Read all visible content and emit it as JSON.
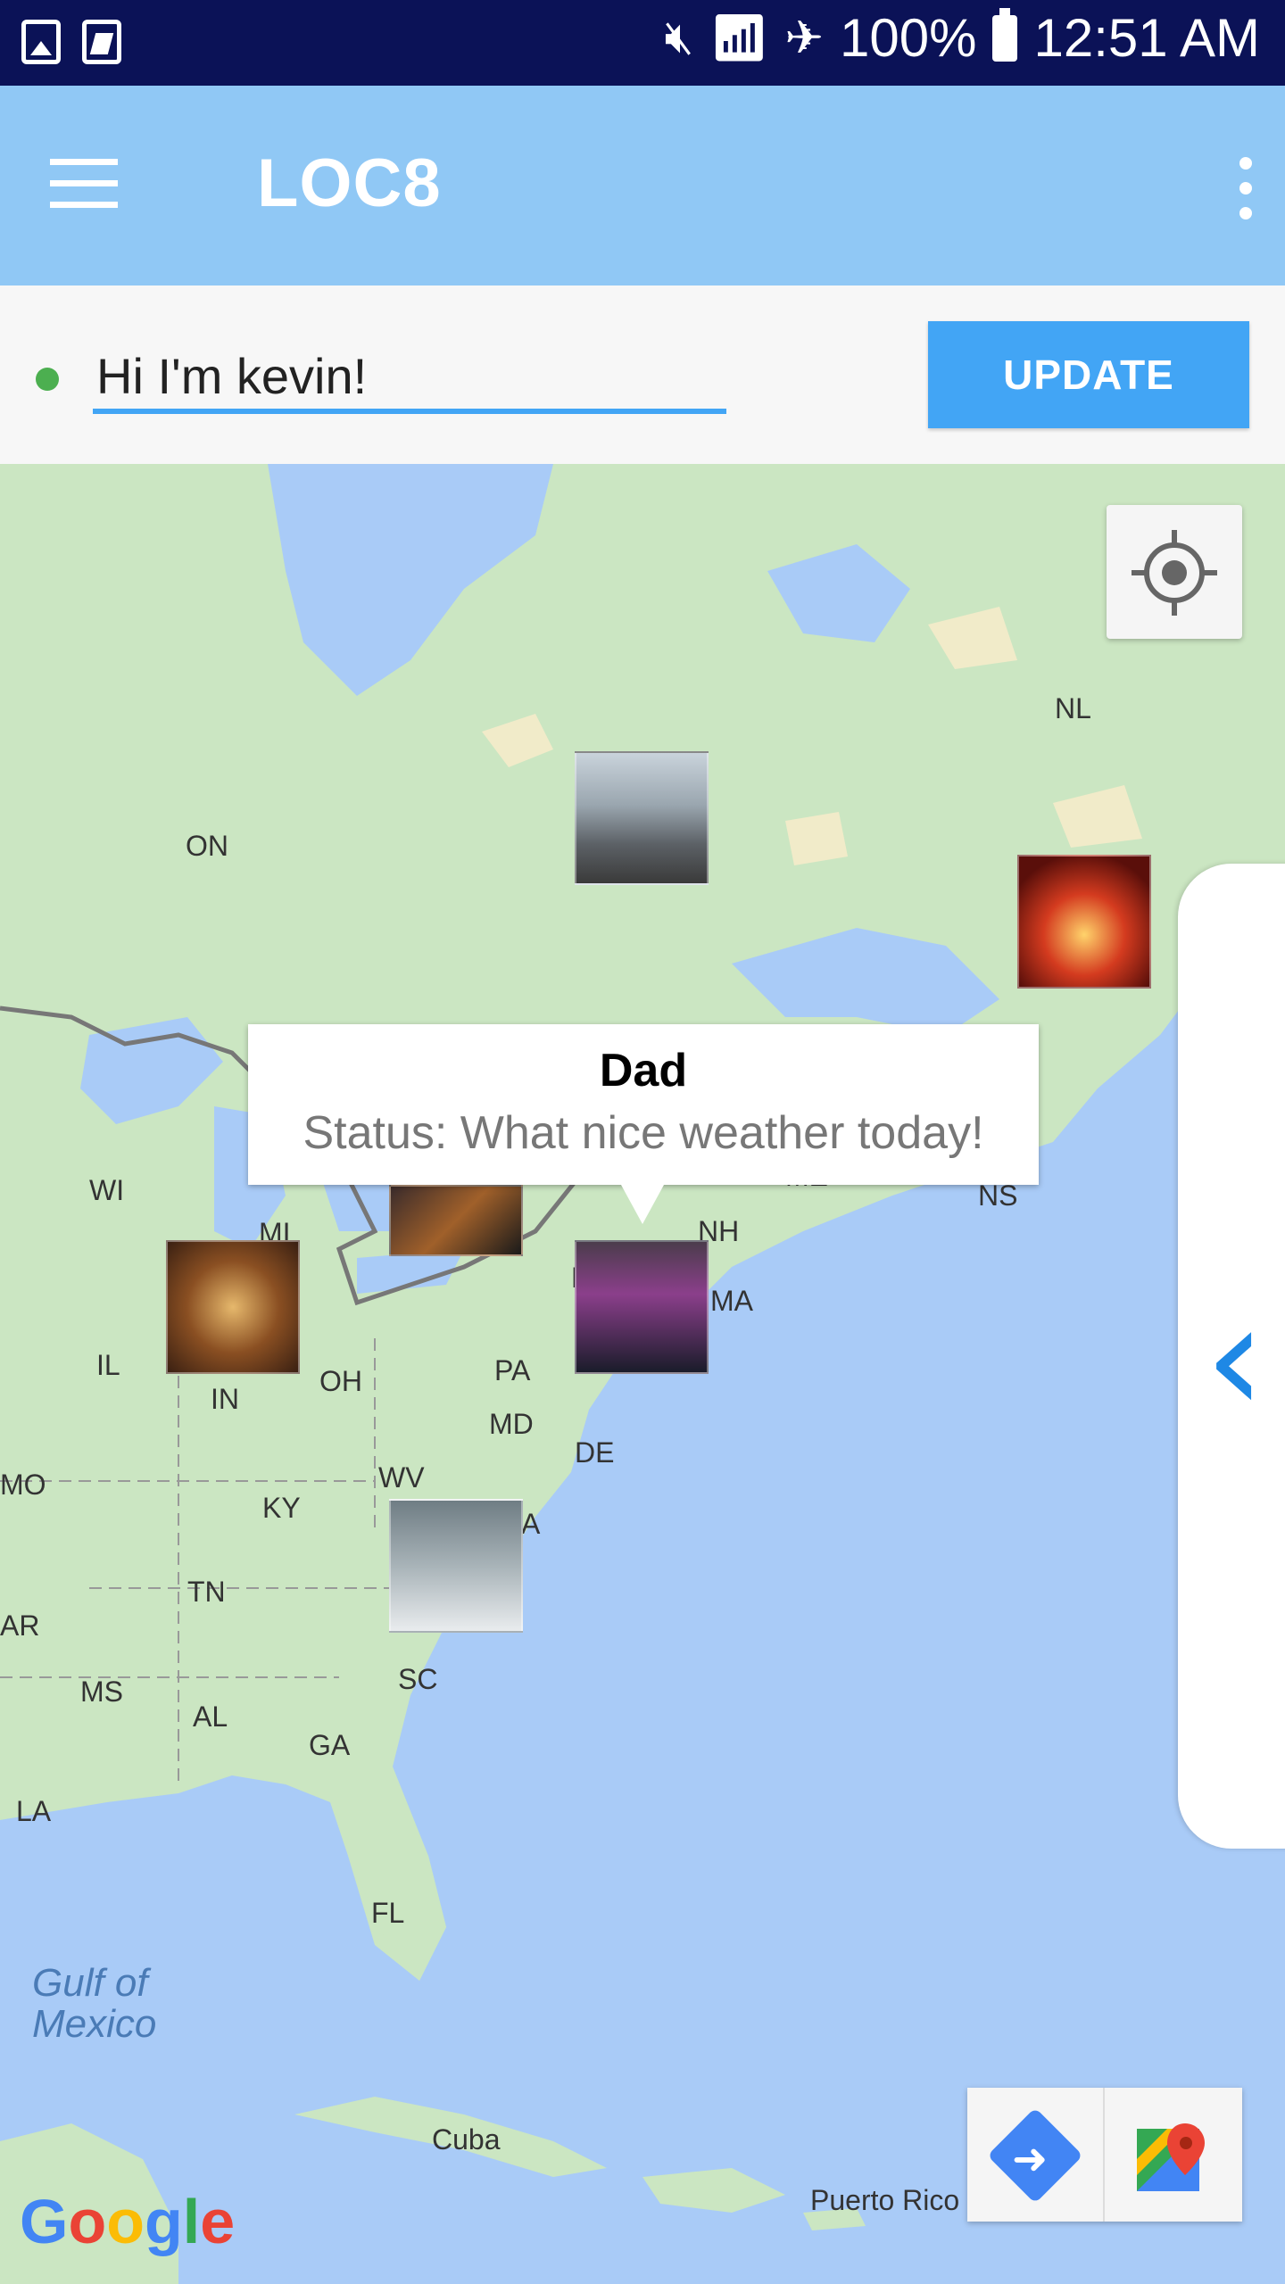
{
  "status_bar": {
    "battery": "100%",
    "time": "12:51 AM",
    "icons": [
      "gallery-icon",
      "sim-icon",
      "mute-icon",
      "wifi-icon",
      "airplane-icon",
      "battery-icon"
    ]
  },
  "app_bar": {
    "title": "LOC8",
    "menu_icon": "hamburger-icon",
    "overflow_icon": "more-vert-icon"
  },
  "status_update": {
    "value": "Hi I'm kevin!",
    "button_label": "UPDATE",
    "online_color": "#4caf50"
  },
  "map": {
    "labels": [
      "NL",
      "ON",
      "WI",
      "MI",
      "IL",
      "IN",
      "OH",
      "PA",
      "MD",
      "DE",
      "WV",
      "KY",
      "TN",
      "MO",
      "AR",
      "MS",
      "AL",
      "GA",
      "SC",
      "LA",
      "FL",
      "NH",
      "MA",
      "NS",
      "A",
      "N",
      "ME",
      "Cuba",
      "Puerto Rico"
    ],
    "sea_label": "Gulf of Mexico",
    "sea_label_lines": [
      "Gulf of",
      "Mexico"
    ],
    "attribution": "Google",
    "info_window": {
      "title": "Dad",
      "status": "Status: What nice weather today!"
    },
    "markers": [
      "photo-marker-quebec",
      "photo-marker-nl",
      "photo-marker-dad",
      "photo-marker-indiana",
      "photo-marker-michigan",
      "photo-marker-virginia"
    ]
  },
  "colors": {
    "status_bar": "#0b1257",
    "app_bar": "#90c8f5",
    "accent": "#42a5f5",
    "water": "#a9cbf7",
    "land": "#c8e6c0"
  }
}
